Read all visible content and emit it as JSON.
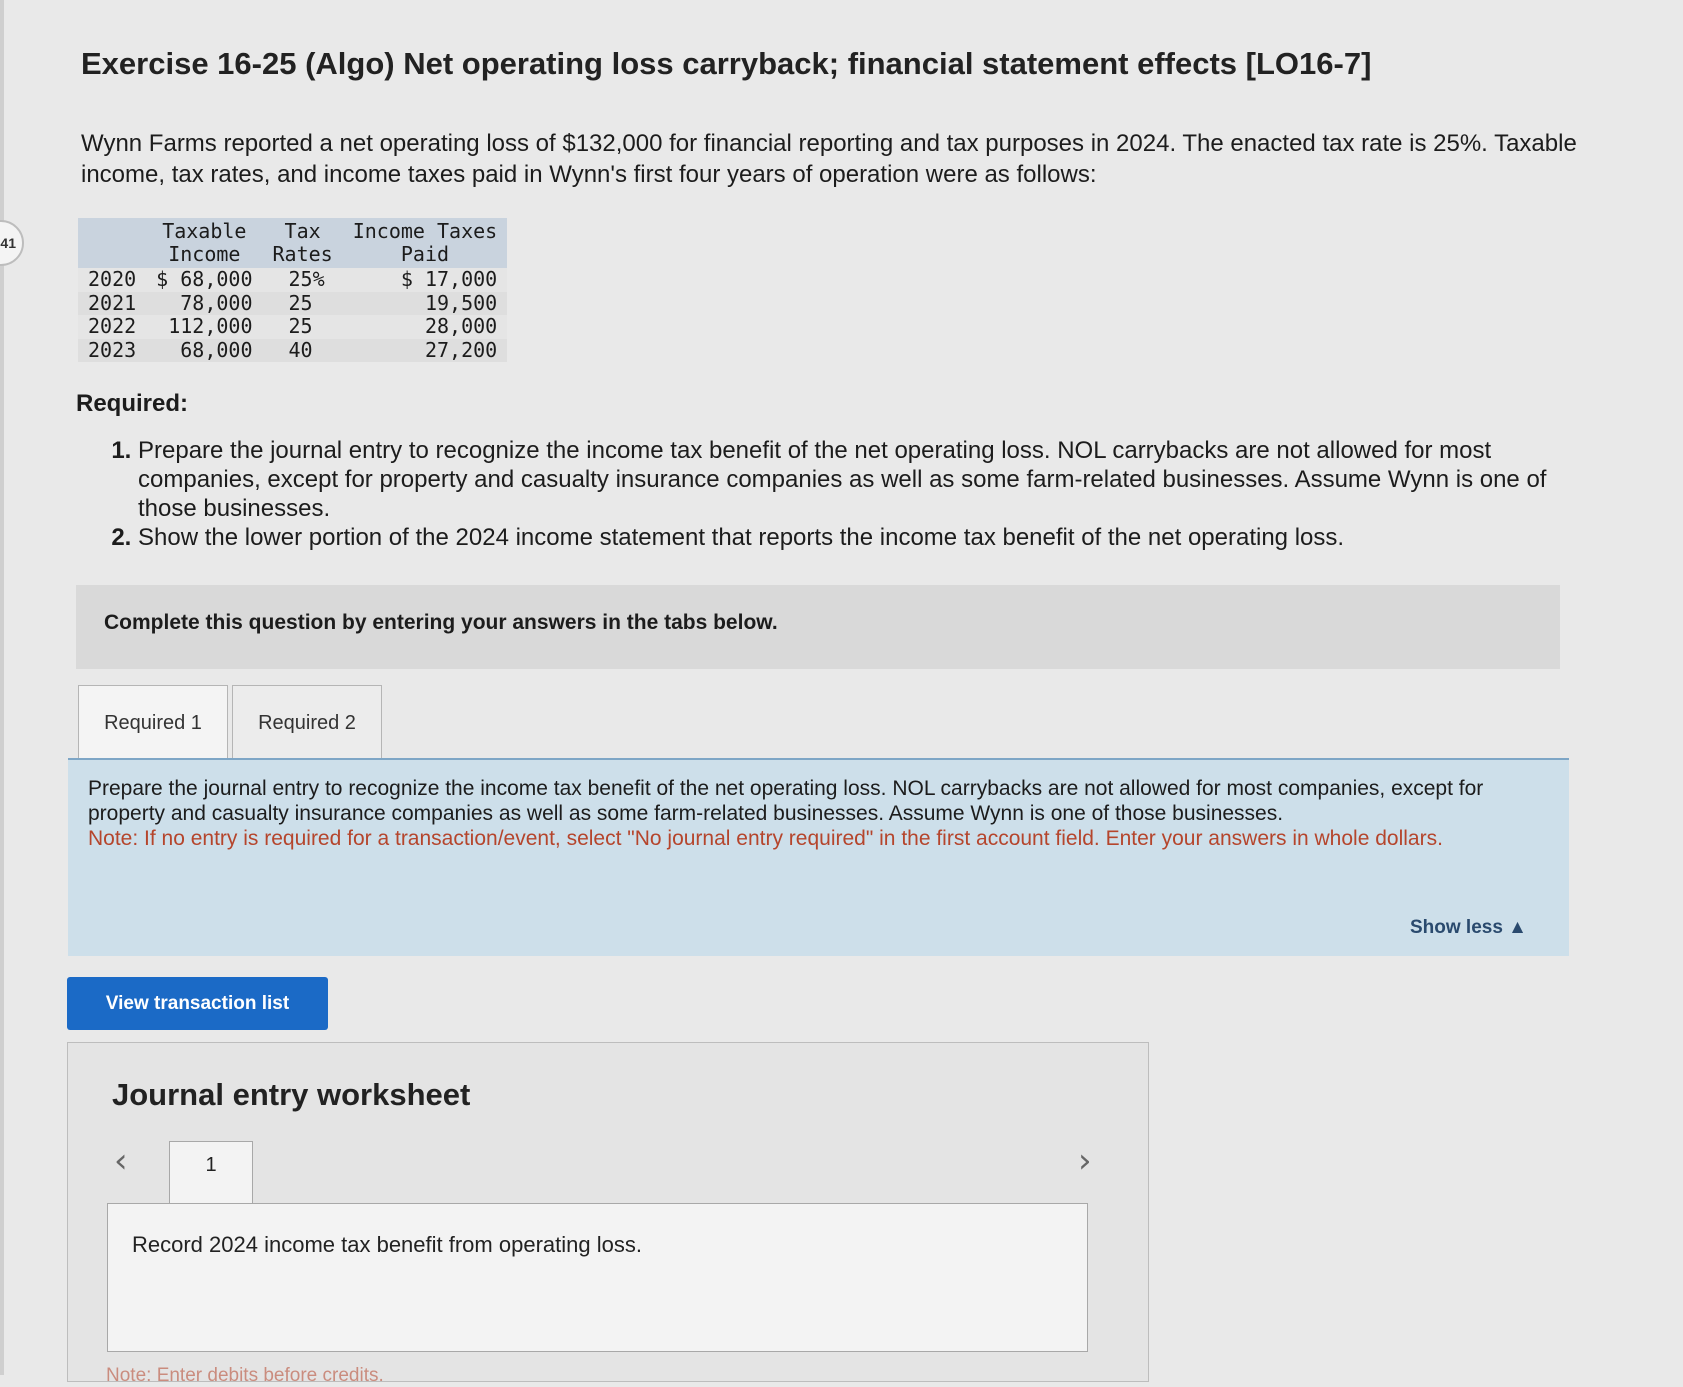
{
  "side_badge": "41",
  "title": "Exercise 16-25 (Algo) Net operating loss carryback; financial statement effects [LO16-7]",
  "intro": "Wynn Farms reported a net operating loss of $132,000 for financial reporting and tax purposes in 2024. The enacted tax rate is 25%. Taxable income, tax rates, and income taxes paid in Wynn's first four years of operation were as follows:",
  "table": {
    "headers": {
      "income_1": "Taxable",
      "income_2": "Income",
      "rate_1": "Tax",
      "rate_2": "Rates",
      "paid_1": "Income Taxes",
      "paid_2": "Paid"
    },
    "rows": [
      {
        "year": "2020",
        "income": "$ 68,000",
        "rate": "25%",
        "paid": "$ 17,000"
      },
      {
        "year": "2021",
        "income": "78,000",
        "rate": "25",
        "paid": "19,500"
      },
      {
        "year": "2022",
        "income": "112,000",
        "rate": "25",
        "paid": "28,000"
      },
      {
        "year": "2023",
        "income": "68,000",
        "rate": "40",
        "paid": "27,200"
      }
    ]
  },
  "required_heading": "Required:",
  "required_items": [
    "Prepare the journal entry to recognize the income tax benefit of the net operating loss. NOL carrybacks are not allowed for most companies, except for property and casualty insurance companies as well as some farm-related businesses. Assume Wynn is one of those businesses.",
    "Show the lower portion of the 2024 income statement that reports the income tax benefit of the net operating loss."
  ],
  "complete_text": "Complete this question by entering your answers in the tabs below.",
  "tabs": [
    "Required 1",
    "Required 2"
  ],
  "instructions": {
    "text": "Prepare the journal entry to recognize the income tax benefit of the net operating loss. NOL carrybacks are not allowed for most companies, except for property and casualty insurance companies as well as some farm-related businesses. Assume Wynn is one of those businesses.",
    "note": "Note: If no entry is required for a transaction/event, select \"No journal entry required\" in the first account field. Enter your answers in whole dollars.",
    "show_less": "Show less ▲"
  },
  "view_button": "View transaction list",
  "worksheet": {
    "title": "Journal entry worksheet",
    "prev_icon": "chevron-left-icon",
    "next_icon": "chevron-right-icon",
    "entry_tab": "1",
    "entry_description": "Record 2024 income tax benefit from operating loss.",
    "footer_note": "Note: Enter debits before credits."
  }
}
